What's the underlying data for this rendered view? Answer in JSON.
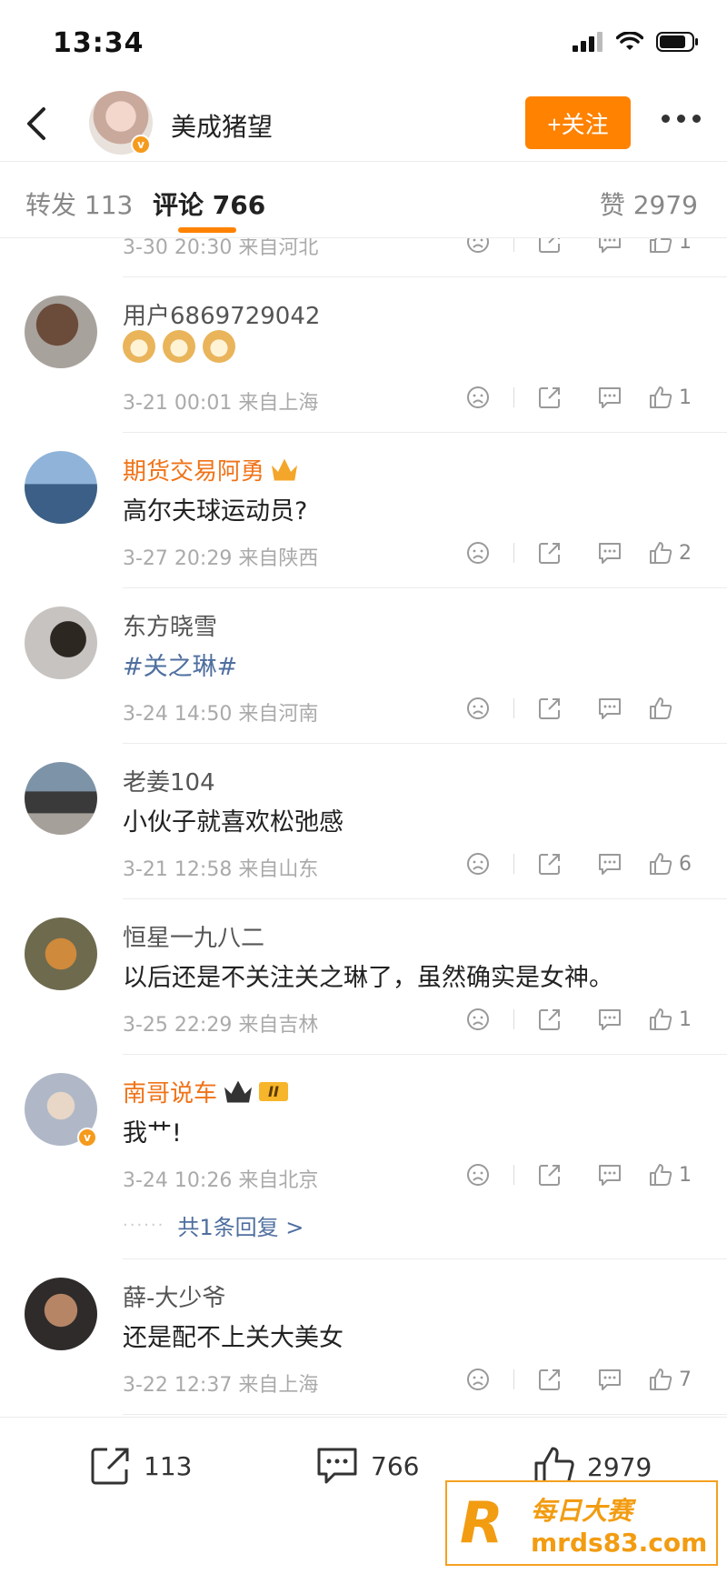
{
  "status_bar": {
    "time": "13:34"
  },
  "header": {
    "name": "美成猪望",
    "follow_label": "+关注"
  },
  "tabs": {
    "repost": "转发 113",
    "comments": "评论 766",
    "likes": "赞 2979"
  },
  "partial_row": {
    "meta": "3-30 20:30  来自河北",
    "likes": "1"
  },
  "comments": [
    {
      "name": "用户6869729042",
      "text": "",
      "emoji": [
        "doge",
        "doge",
        "doge"
      ],
      "meta": "3-21 00:01  来自上海",
      "likes": "1"
    },
    {
      "name": "期货交易阿勇",
      "text": "高尔夫球运动员?",
      "meta": "3-27 20:29  来自陕西",
      "likes": "2"
    },
    {
      "name": "东方晓雪",
      "text": "#关之琳#",
      "meta": "3-24 14:50  来自河南",
      "likes": ""
    },
    {
      "name": "老姜104",
      "text": "小伙子就喜欢松弛感",
      "meta": "3-21 12:58  来自山东",
      "likes": "6"
    },
    {
      "name": "恒星一九八二",
      "text": "以后还是不关注关之琳了，虽然确实是女神。",
      "meta": "3-25 22:29  来自吉林",
      "likes": "1"
    },
    {
      "name": "南哥说车",
      "text": "我艹!",
      "meta": "3-24 10:26  来自北京",
      "likes": "1",
      "badge": "II",
      "replies": "共1条回复 >"
    },
    {
      "name": "薛-大少爷",
      "text": "还是配不上关大美女",
      "meta": "3-22 12:37  来自上海",
      "likes": "7"
    }
  ],
  "bottom_bar": {
    "reposts": "113",
    "comments": "766",
    "likes": "2979"
  },
  "watermark": {
    "line1": "每日大赛",
    "line2": "mrds83.com",
    "logo": "R"
  },
  "colors": {
    "accent": "#ff8200",
    "link": "#4f6f9f",
    "vip_name": "#f07318"
  }
}
